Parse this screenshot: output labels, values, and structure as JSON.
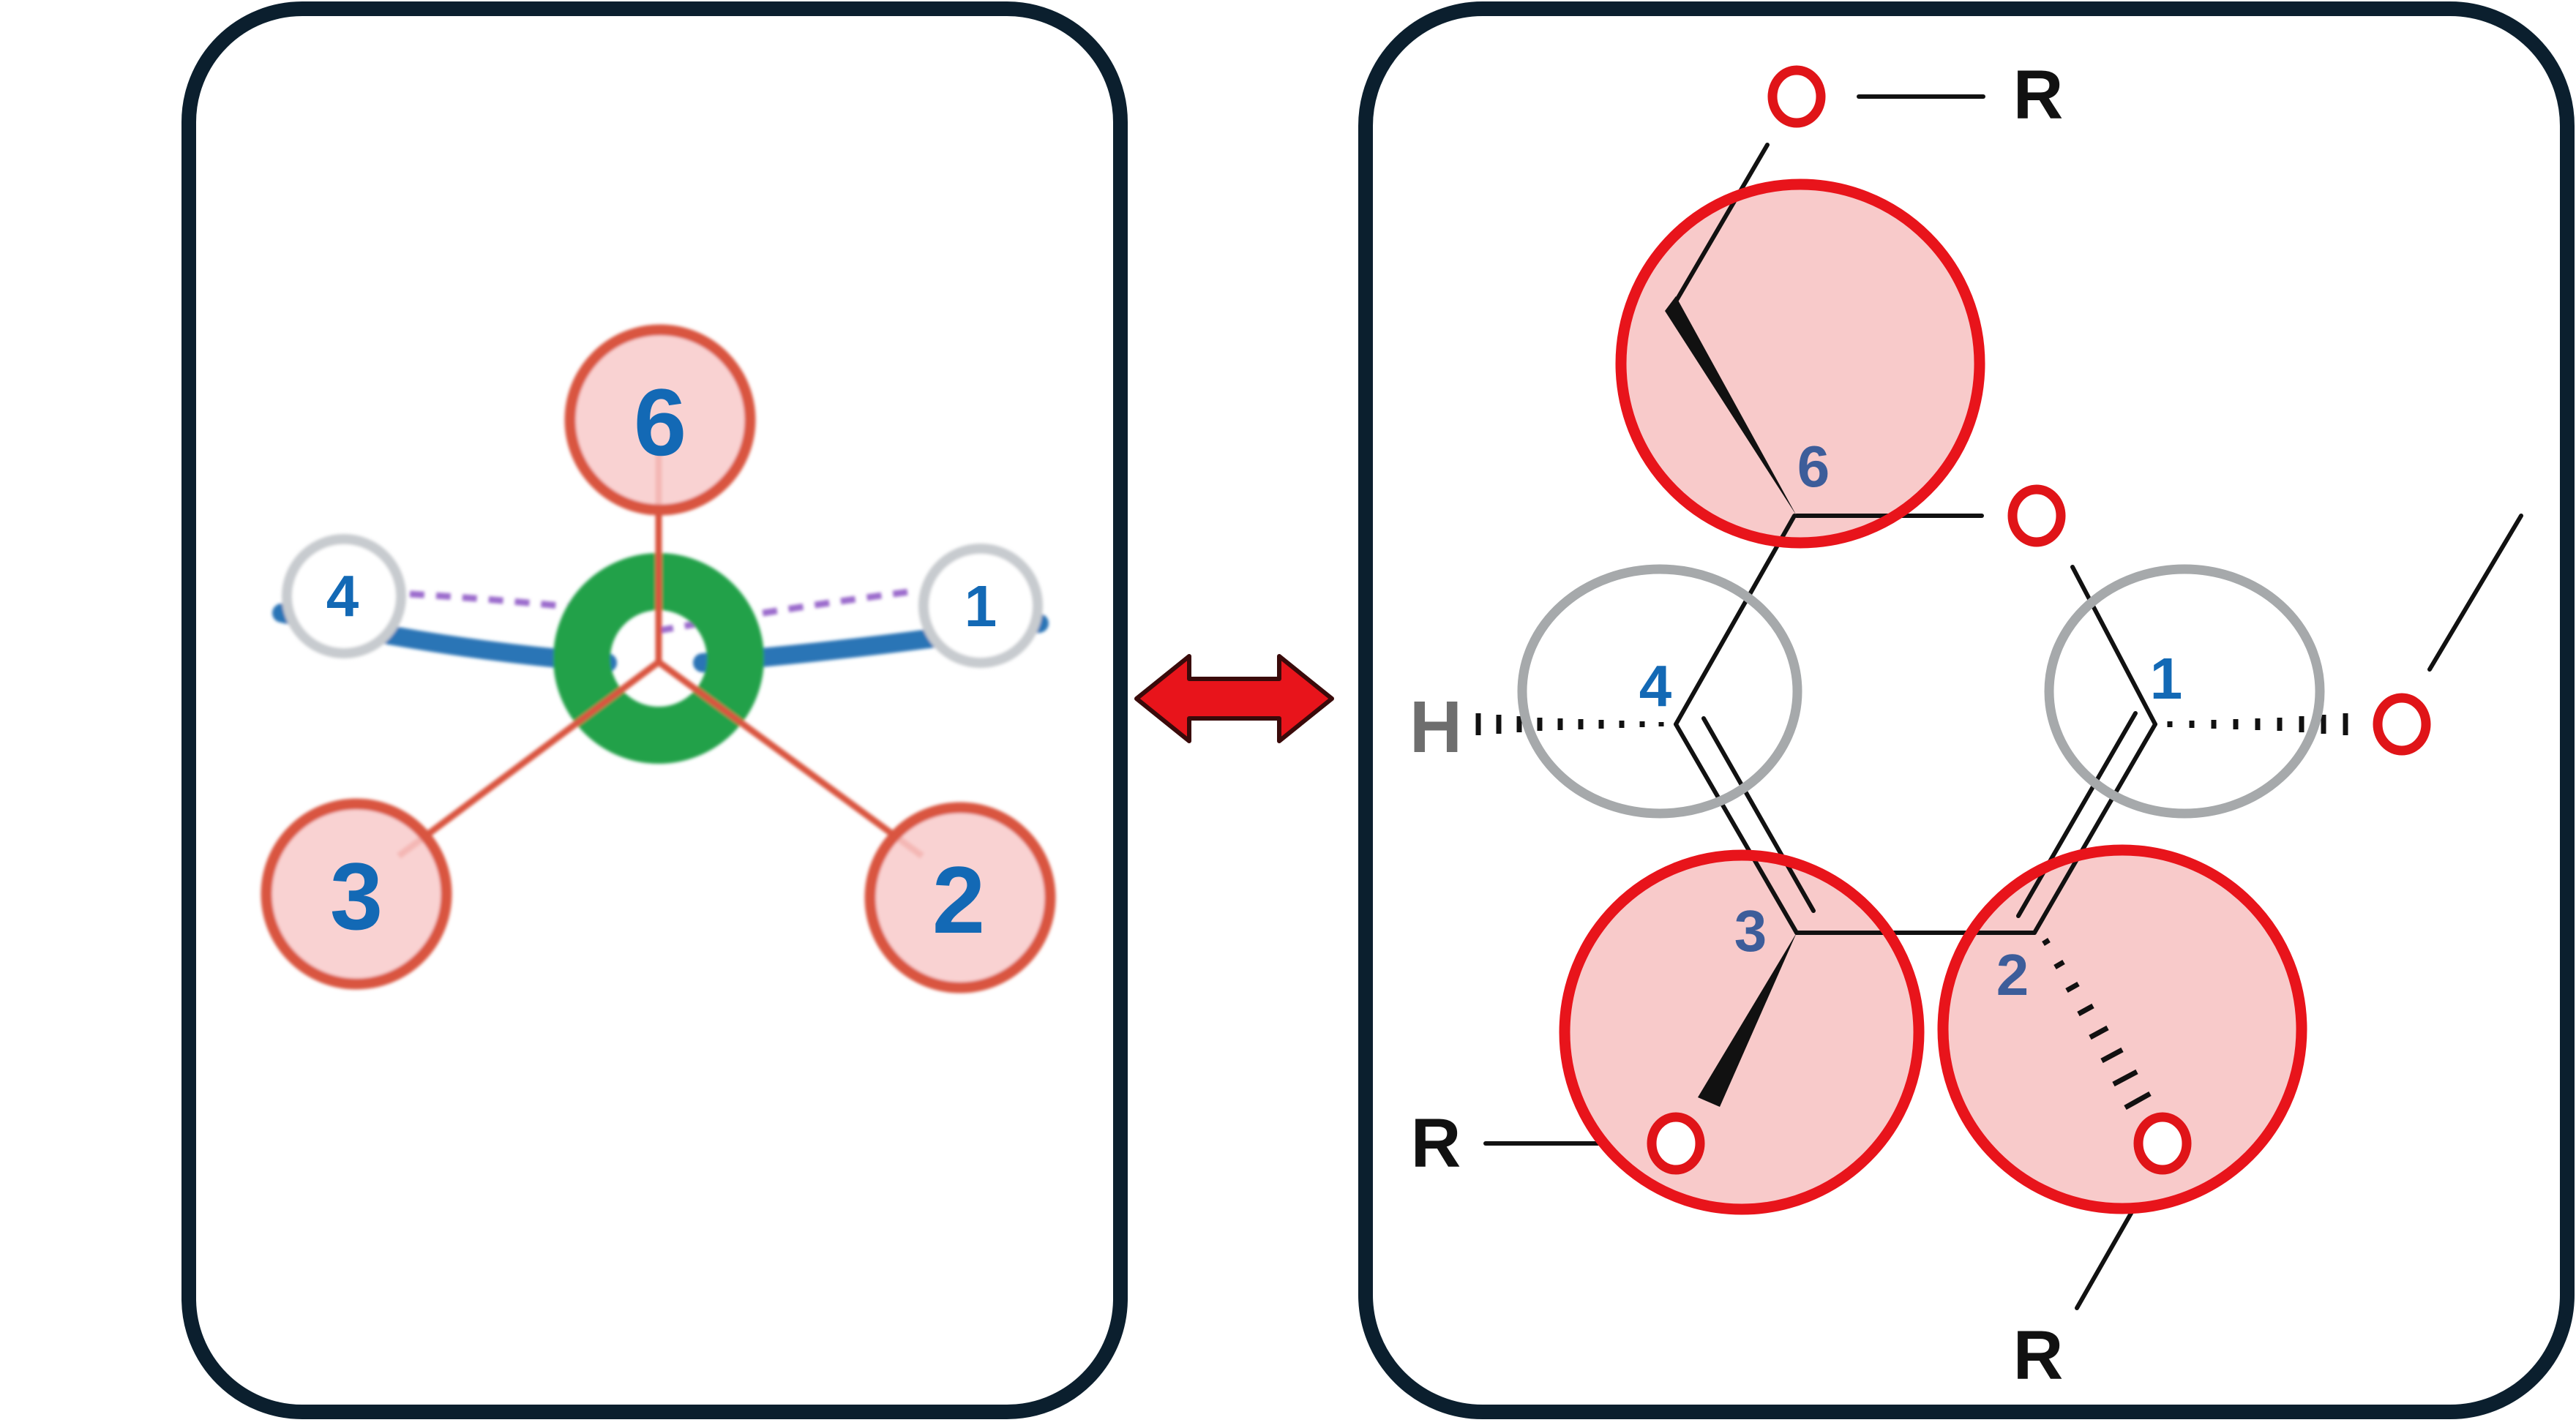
{
  "colors": {
    "panel_border": "#0b1f2e",
    "highlight_red": "#e8141b",
    "highlight_fill": "#f8caca",
    "left_circle_red": "#d9543f",
    "neutral_gray": "#a6a9ab",
    "number_blue": "#1369b5",
    "center_green": "#22a14a",
    "bond_blue": "#2c74b6",
    "dashed_purple": "#9b6ccc",
    "label_slate": "#3d5d9a",
    "oxygen_red": "#e01418",
    "arrow_red": "#e8141b",
    "arrow_outline": "#3a0a0a",
    "text_black": "#111111",
    "hydrogen_gray": "#6e6e6e"
  },
  "left_panel": {
    "position_labels": {
      "p6": "6",
      "p4": "4",
      "p1": "1",
      "p3": "3",
      "p2": "2"
    }
  },
  "connector": {
    "icon": "double-headed-arrow-icon"
  },
  "right_panel": {
    "carbon_labels": {
      "c6": "6",
      "c4": "4",
      "c1": "1",
      "c3": "3",
      "c2": "2"
    },
    "atoms": {
      "o_top": "O",
      "r_top": "R",
      "o_ring": "O",
      "h_left": "H",
      "o_right": "O",
      "o_bottom_left": "O",
      "r_bottom_left": "R",
      "o_bottom_right": "O",
      "r_bottom": "R"
    }
  }
}
